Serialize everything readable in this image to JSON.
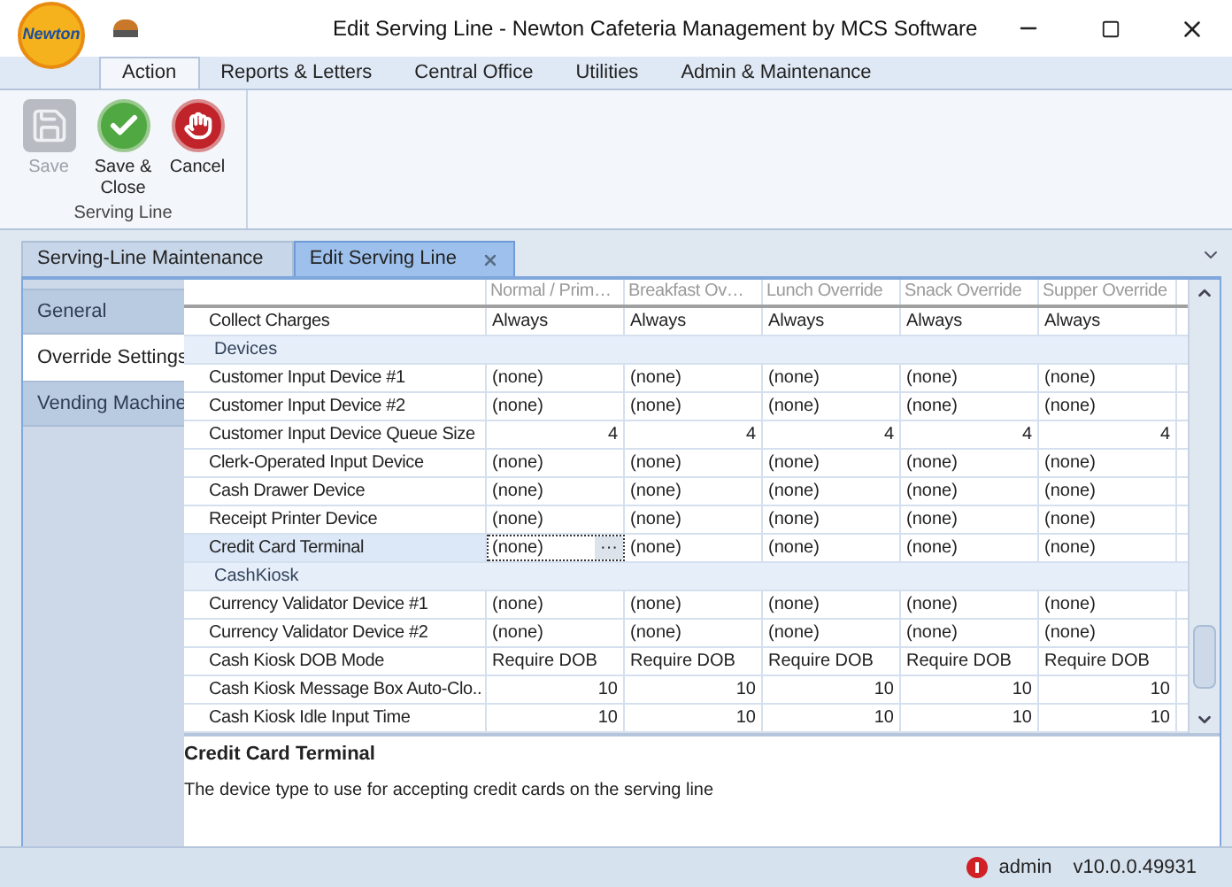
{
  "window": {
    "title": "Edit Serving Line - Newton Cafeteria Management by MCS Software",
    "logo_text": "Newton"
  },
  "ribbon_tabs": [
    {
      "label": "Action",
      "selected": true
    },
    {
      "label": "Reports & Letters",
      "selected": false
    },
    {
      "label": "Central Office",
      "selected": false
    },
    {
      "label": "Utilities",
      "selected": false
    },
    {
      "label": "Admin & Maintenance",
      "selected": false
    }
  ],
  "ribbon_group": {
    "label": "Serving Line",
    "buttons": [
      {
        "kind": "save",
        "label": "Save",
        "disabled": true
      },
      {
        "kind": "save_close",
        "label": "Save &\nClose",
        "disabled": false
      },
      {
        "kind": "cancel",
        "label": "Cancel",
        "disabled": false
      }
    ]
  },
  "document_tabs": [
    {
      "label": "Serving-Line Maintenance",
      "selected": false,
      "closable": false
    },
    {
      "label": "Edit Serving Line",
      "selected": true,
      "closable": true
    }
  ],
  "side_nav": [
    {
      "label": "General",
      "selected": false
    },
    {
      "label": "Override Settings",
      "selected": true
    },
    {
      "label": "Vending Machine",
      "selected": false
    }
  ],
  "grid": {
    "columns": [
      "Normal / Prim…",
      "Breakfast Ov…",
      "Lunch Override",
      "Snack Override",
      "Supper Override"
    ],
    "rows": [
      {
        "kind": "text",
        "label": "Collect Charges",
        "values": [
          "Always",
          "Always",
          "Always",
          "Always",
          "Always"
        ],
        "selected": false
      },
      {
        "kind": "group",
        "label": "Devices"
      },
      {
        "kind": "text",
        "label": "Customer Input Device #1",
        "values": [
          "(none)",
          "(none)",
          "(none)",
          "(none)",
          "(none)"
        ],
        "selected": false
      },
      {
        "kind": "text",
        "label": "Customer Input Device #2",
        "values": [
          "(none)",
          "(none)",
          "(none)",
          "(none)",
          "(none)"
        ],
        "selected": false
      },
      {
        "kind": "number",
        "label": "Customer Input Device Queue Size",
        "values": [
          "4",
          "4",
          "4",
          "4",
          "4"
        ],
        "selected": false
      },
      {
        "kind": "text",
        "label": "Clerk-Operated Input Device",
        "values": [
          "(none)",
          "(none)",
          "(none)",
          "(none)",
          "(none)"
        ],
        "selected": false
      },
      {
        "kind": "text",
        "label": "Cash Drawer Device",
        "values": [
          "(none)",
          "(none)",
          "(none)",
          "(none)",
          "(none)"
        ],
        "selected": false
      },
      {
        "kind": "text",
        "label": "Receipt Printer Device",
        "values": [
          "(none)",
          "(none)",
          "(none)",
          "(none)",
          "(none)"
        ],
        "selected": false
      },
      {
        "kind": "text",
        "label": "Credit Card Terminal",
        "values": [
          "(none)",
          "(none)",
          "(none)",
          "(none)",
          "(none)"
        ],
        "selected": true,
        "editor_button": "···"
      },
      {
        "kind": "group",
        "label": "CashKiosk"
      },
      {
        "kind": "text",
        "label": "Currency Validator Device #1",
        "values": [
          "(none)",
          "(none)",
          "(none)",
          "(none)",
          "(none)"
        ],
        "selected": false
      },
      {
        "kind": "text",
        "label": "Currency Validator Device #2",
        "values": [
          "(none)",
          "(none)",
          "(none)",
          "(none)",
          "(none)"
        ],
        "selected": false
      },
      {
        "kind": "text",
        "label": "Cash Kiosk DOB Mode",
        "values": [
          "Require DOB",
          "Require DOB",
          "Require DOB",
          "Require DOB",
          "Require DOB"
        ],
        "selected": false
      },
      {
        "kind": "number",
        "label": "Cash Kiosk Message Box Auto-Clo..",
        "values": [
          "10",
          "10",
          "10",
          "10",
          "10"
        ],
        "selected": false
      },
      {
        "kind": "number",
        "label": "Cash Kiosk Idle Input Time",
        "values": [
          "10",
          "10",
          "10",
          "10",
          "10"
        ],
        "selected": false
      }
    ]
  },
  "description": {
    "title": "Credit Card Terminal",
    "text": "The device type to use for accepting credit cards on the serving line"
  },
  "status_bar": {
    "user": "admin",
    "version": "v10.0.0.49931"
  }
}
